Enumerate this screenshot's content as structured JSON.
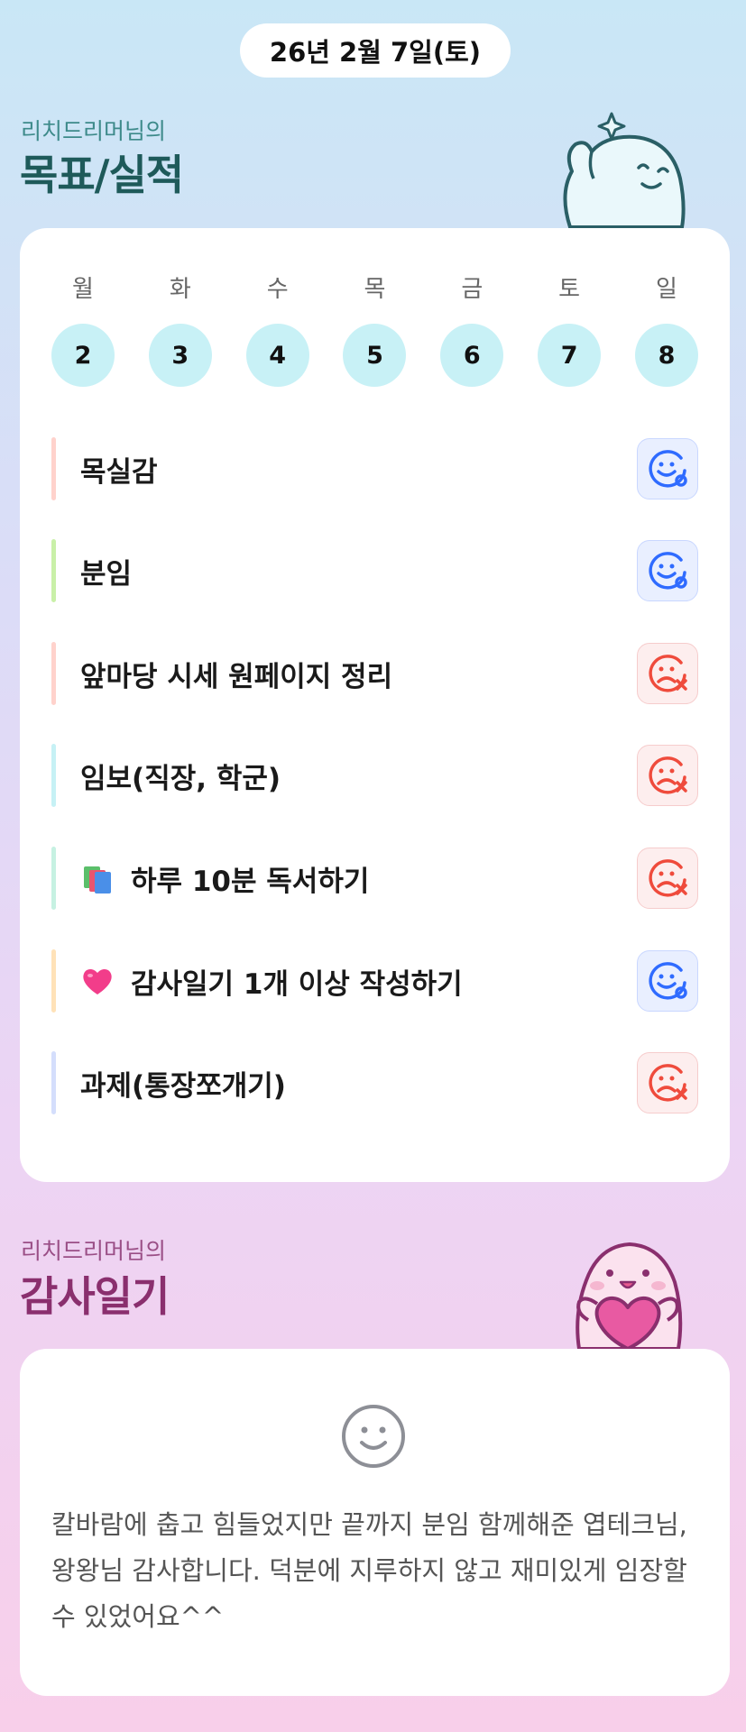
{
  "date": "26년 2월 7일(토)",
  "goals_section": {
    "subtitle": "리치드리머님의",
    "title": "목표/실적"
  },
  "week": [
    {
      "label": "월",
      "num": "2"
    },
    {
      "label": "화",
      "num": "3"
    },
    {
      "label": "수",
      "num": "4"
    },
    {
      "label": "목",
      "num": "5"
    },
    {
      "label": "금",
      "num": "6"
    },
    {
      "label": "토",
      "num": "7"
    },
    {
      "label": "일",
      "num": "8"
    }
  ],
  "goals": [
    {
      "text": "목실감",
      "status": "done",
      "bar_color": "#ffd2cc"
    },
    {
      "text": "분임",
      "status": "done",
      "bar_color": "#c9f0a8"
    },
    {
      "text": "앞마당 시세 원페이지 정리",
      "status": "fail",
      "bar_color": "#ffd2cc"
    },
    {
      "text": "임보(직장, 학군)",
      "status": "fail",
      "bar_color": "#c6f1f5"
    },
    {
      "text": "하루 10분 독서하기",
      "status": "fail",
      "bar_color": "#c6f1e2",
      "icon": "books-icon"
    },
    {
      "text": "감사일기 1개 이상 작성하기",
      "status": "done",
      "bar_color": "#ffe2b8",
      "icon": "heart-icon"
    },
    {
      "text": "과제(통장쪼개기)",
      "status": "fail",
      "bar_color": "#d4defc"
    }
  ],
  "gratitude_section": {
    "subtitle": "리치드리머님의",
    "title": "감사일기"
  },
  "gratitude": {
    "icon": "smile-icon",
    "text": "칼바람에 춥고 힘들었지만 끝까지 분임 함께해준 엽테크님,왕왕님 감사합니다. 덕분에 지루하지 않고 재미있게 임장할 수 있었어요^^"
  },
  "colors": {
    "done": "#2f6bff",
    "fail": "#ef4b3c",
    "day_bg": "#c8f1f6"
  }
}
